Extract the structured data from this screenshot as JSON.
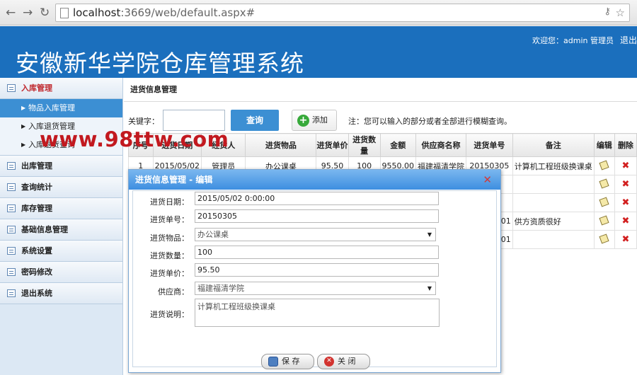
{
  "browser": {
    "back": "←",
    "forward": "→",
    "reload": "↻",
    "url_host": "localhost",
    "url_rest": ":3669/web/default.aspx#",
    "bookmark": "☆"
  },
  "header": {
    "title": "安徽新华学院仓库管理系统",
    "welcome": "欢迎您：admin 管理员",
    "logout": "退出"
  },
  "sidebar": {
    "menus": [
      {
        "label": "入库管理",
        "active": true
      },
      {
        "label": "出库管理"
      },
      {
        "label": "查询统计"
      },
      {
        "label": "库存管理"
      },
      {
        "label": "基础信息管理"
      },
      {
        "label": "系统设置"
      },
      {
        "label": "密码修改"
      },
      {
        "label": "退出系统"
      }
    ],
    "subitems": [
      {
        "label": "物品入库管理"
      },
      {
        "label": "入库退货管理"
      },
      {
        "label": "入库退货查询"
      }
    ]
  },
  "main": {
    "breadcrumb": "进货信息管理",
    "search_label": "关键字：",
    "search_value": "",
    "query_button": "查询",
    "add_button": "添加",
    "note": "注：您可以输入的部分或者全部进行模糊查询。",
    "columns": [
      "序号",
      "进货日期",
      "经货人",
      "进货物品",
      "进货单价",
      "进货数量",
      "金额",
      "供应商名称",
      "进货单号",
      "备注",
      "编辑",
      "删除"
    ],
    "rows": [
      [
        "1",
        "2015/05/02",
        "管理员",
        "办公课桌",
        "95.50",
        "100",
        "9550.00",
        "福建福清学院",
        "20150305",
        "计算机工程班级换课桌"
      ],
      [
        "",
        "",
        "",
        "",
        "",
        "",
        "",
        "",
        "",
        ""
      ],
      [
        "",
        "",
        "",
        "",
        "",
        "",
        "",
        "",
        "",
        ""
      ],
      [
        "",
        "",
        "",
        "",
        "",
        "",
        "",
        "",
        "01",
        "供方资质很好"
      ],
      [
        "",
        "",
        "",
        "",
        "",
        "",
        "",
        "",
        "01",
        ""
      ]
    ]
  },
  "watermark": "www.98ttw.com",
  "dialog": {
    "title": "进货信息管理 - 编辑",
    "close": "✕",
    "date_label": "进货日期：",
    "date_value": "2015/05/02 0:00:00",
    "no_label": "进货单号：",
    "no_value": "20150305",
    "item_label": "进货物品：",
    "item_value": "办公课桌",
    "qty_label": "进货数量：",
    "qty_value": "100",
    "price_label": "进货单价：",
    "price_value": "95.50",
    "supplier_label": "供应商：",
    "supplier_value": "福建福清学院",
    "desc_label": "进货说明：",
    "desc_value": "计算机工程班级换课桌",
    "save": "保 存",
    "close_btn": "关 闭"
  }
}
